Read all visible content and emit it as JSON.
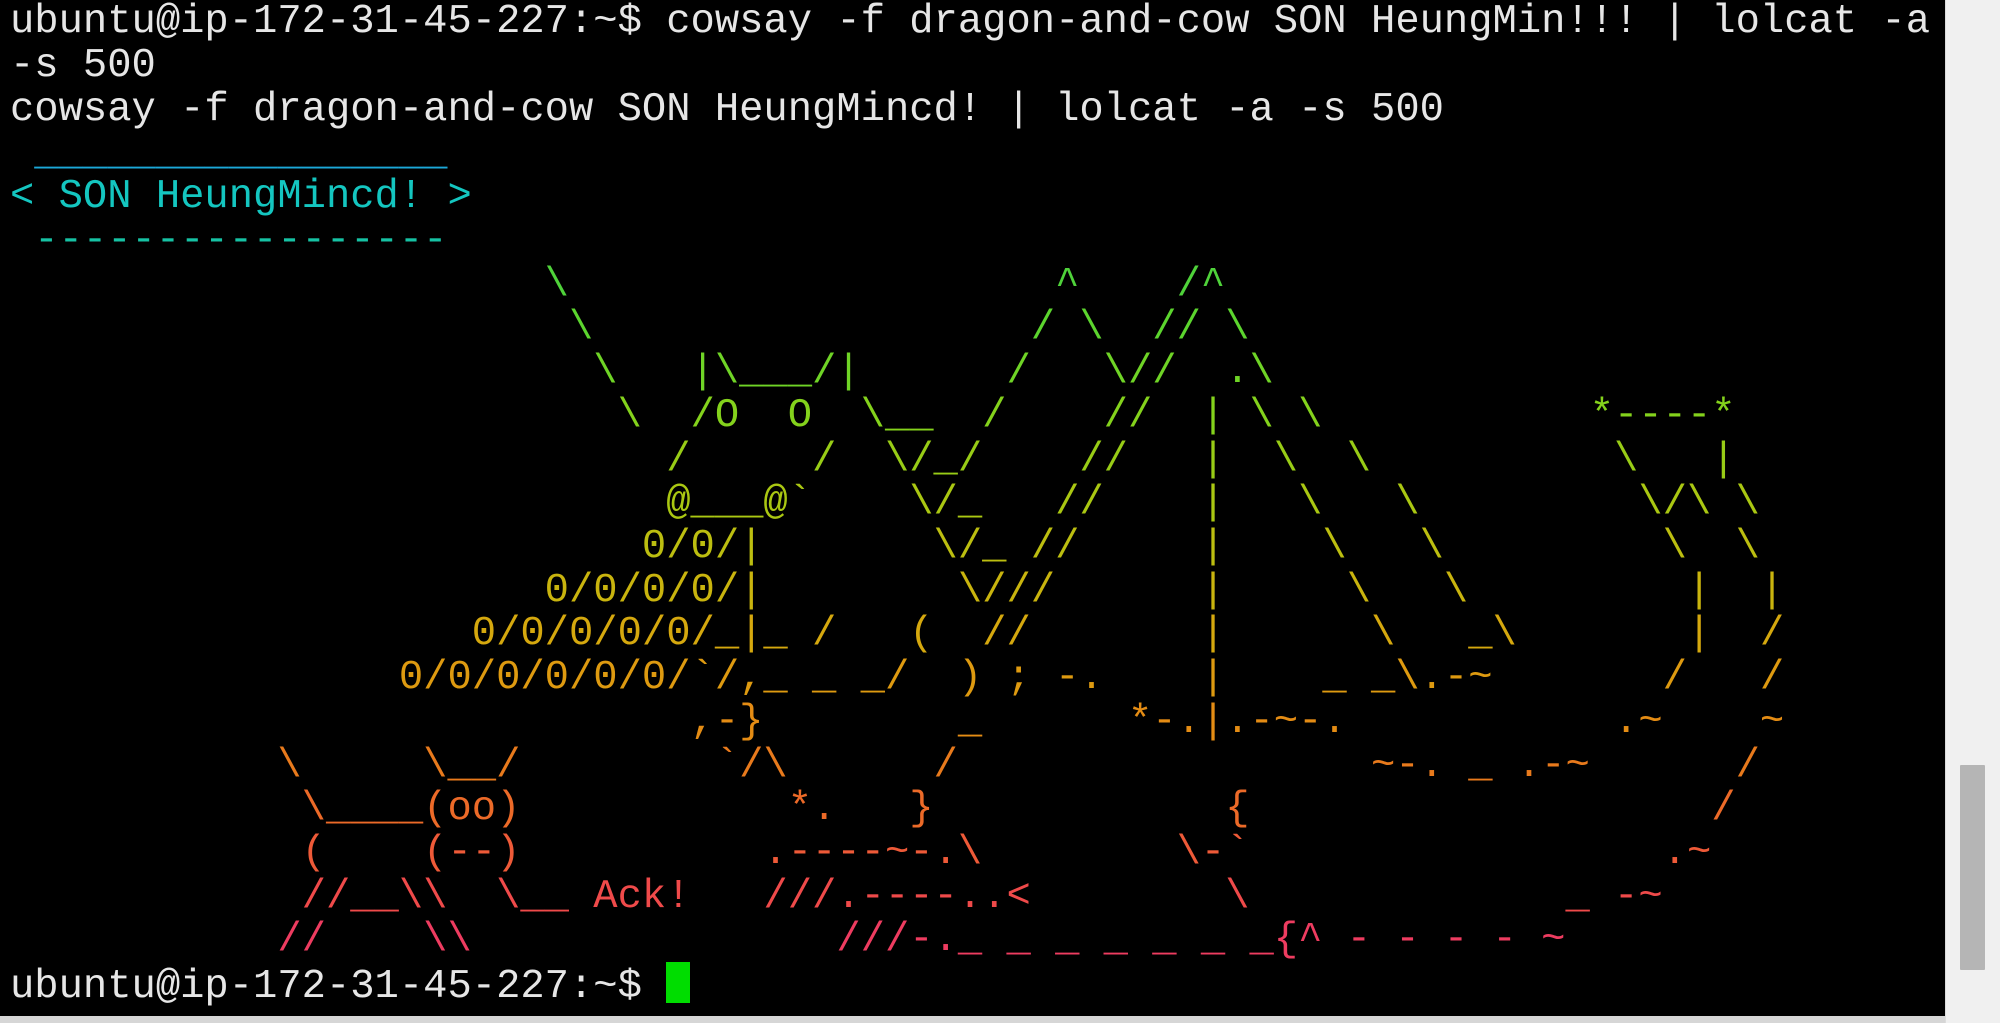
{
  "terminal": {
    "colors": {
      "background": "#000000",
      "text": "#e6e6e6",
      "cursor": "#00dd00"
    },
    "lines": [
      {
        "text": "ubuntu@ip-172-31-45-227:~$ cowsay -f dragon-and-cow SON HeungMin!!! | lolcat -a",
        "color": "#e6e6e6"
      },
      {
        "text": "-s 500",
        "color": "#e6e6e6"
      },
      {
        "text": "cowsay -f dragon-and-cow SON HeungMincd! | lolcat -a -s 500",
        "color": "#e6e6e6"
      },
      {
        "text": " _________________",
        "color": "#1ba8d8"
      },
      {
        "text": "< SON HeungMincd! >",
        "color": "#14c6c0"
      },
      {
        "text": " -----------------",
        "color": "#16c2a4"
      },
      {
        "text": "                      \\                    ^    /^",
        "color": "#4fd23a"
      },
      {
        "text": "                       \\                  / \\  // \\",
        "color": "#5cd52e"
      },
      {
        "text": "                        \\   |\\___/|      /   \\//  .\\",
        "color": "#6fd426"
      },
      {
        "text": "                         \\  /O  O  \\__  /    //  | \\ \\           *----*",
        "color": "#84d21c"
      },
      {
        "text": "                           /     /  \\/_/    //   |  \\  \\          \\   |",
        "color": "#98cc16"
      },
      {
        "text": "                           @___@`    \\/_   //    |   \\   \\         \\/\\ \\",
        "color": "#aac712"
      },
      {
        "text": "                          0/0/|       \\/_ //     |    \\   \\         \\  \\",
        "color": "#bcbe10"
      },
      {
        "text": "                      0/0/0/0/|        \\///      |     \\   \\         |  |",
        "color": "#c9b40e"
      },
      {
        "text": "                   0/0/0/0/0/_|_ /   (  //       |      \\   _\\       |  /",
        "color": "#d5a80e"
      },
      {
        "text": "                0/0/0/0/0/0/`/,_ _ _/  ) ; -.    |    _ _\\.-~       /   /",
        "color": "#de9a10"
      },
      {
        "text": "                            ,-}        _      *-.|.-~-.           .~    ~",
        "color": "#e48c14"
      },
      {
        "text": "           \\     \\__/        `/\\      /                 ~-. _ .-~      /",
        "color": "#e87a1c"
      },
      {
        "text": "            \\____(oo)           *.   }            {                   /",
        "color": "#ec6a28"
      },
      {
        "text": "            (    (--)          .----~-.\\        \\-`                 .~",
        "color": "#ee5a38"
      },
      {
        "text": "            //__\\\\  \\__ Ack!   ///.----..<        \\             _ -~",
        "color": "#ef4a4a"
      },
      {
        "text": "           //    \\\\               ///-._ _ _ _ _ _ _{^ - - - - ~",
        "color": "#ee3c60"
      },
      {
        "text": "ubuntu@ip-172-31-45-227:~$ ",
        "color": "#e6e6e6",
        "cursor": true
      }
    ]
  }
}
